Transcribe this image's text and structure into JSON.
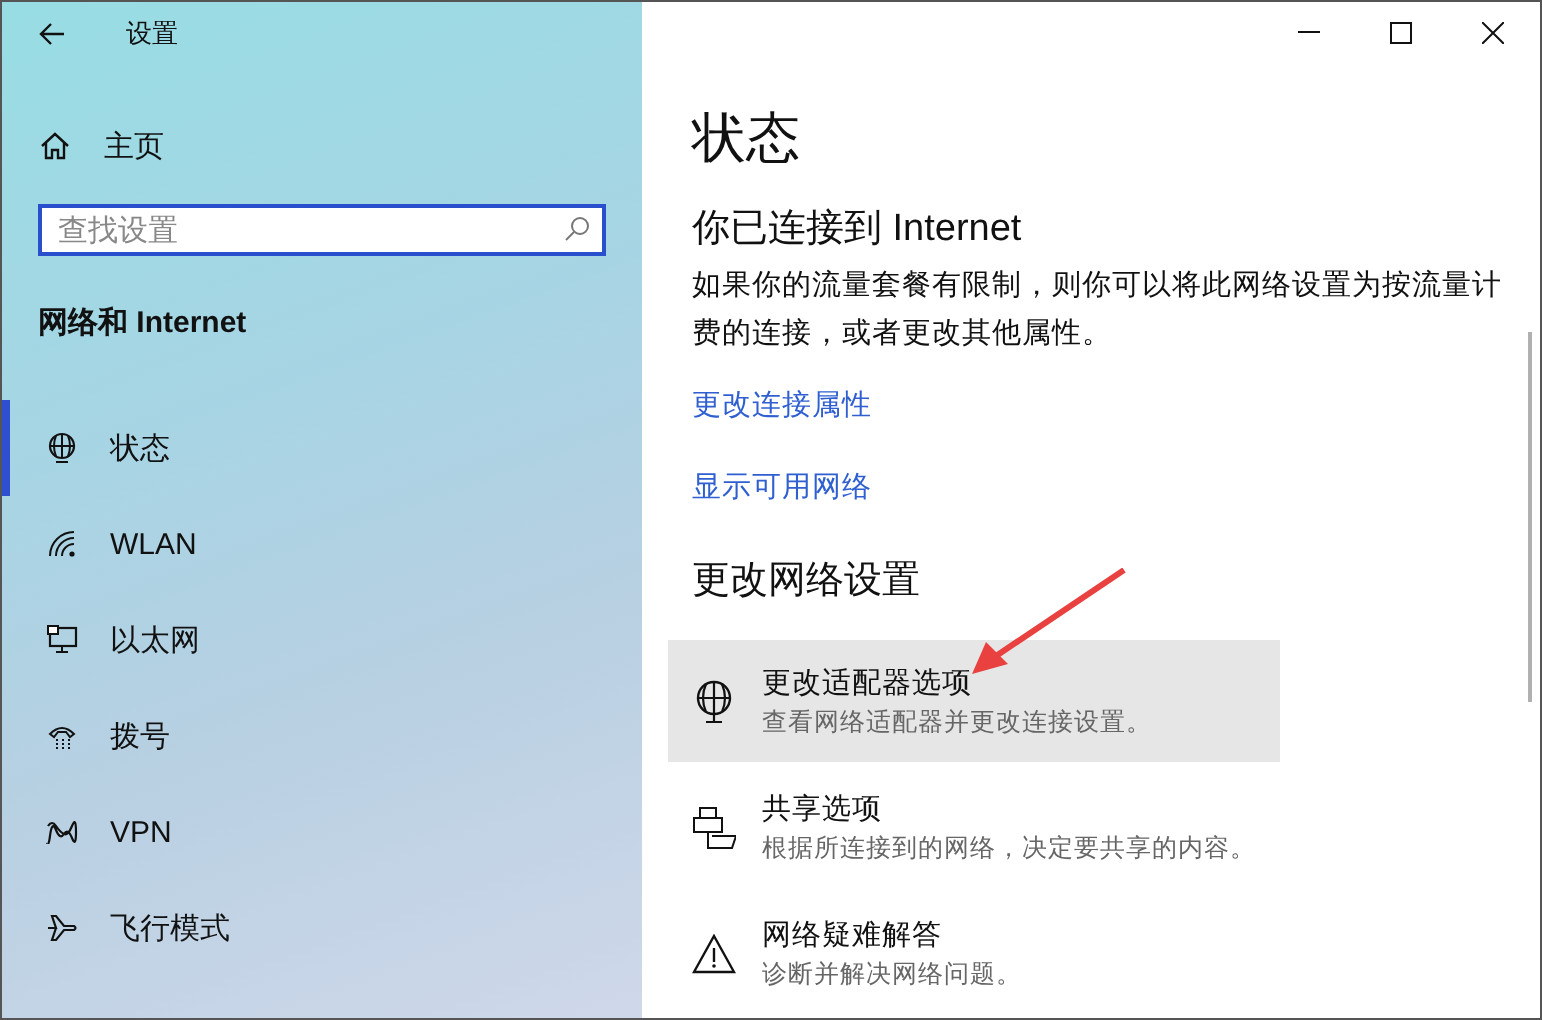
{
  "window": {
    "title": "设置"
  },
  "sidebar": {
    "home": "主页",
    "search": {
      "placeholder": "查找设置"
    },
    "section": "网络和 Internet",
    "items": [
      {
        "label": "状态",
        "selected": true
      },
      {
        "label": "WLAN",
        "selected": false
      },
      {
        "label": "以太网",
        "selected": false
      },
      {
        "label": "拨号",
        "selected": false
      },
      {
        "label": "VPN",
        "selected": false
      },
      {
        "label": "飞行模式",
        "selected": false
      }
    ]
  },
  "content": {
    "title": "状态",
    "heading": "你已连接到 Internet",
    "description": "如果你的流量套餐有限制，则你可以将此网络设置为按流量计费的连接，或者更改其他属性。",
    "links": [
      "更改连接属性",
      "显示可用网络"
    ],
    "section": "更改网络设置",
    "settings": [
      {
        "title": "更改适配器选项",
        "subtitle": "查看网络适配器并更改连接设置。",
        "highlighted": true
      },
      {
        "title": "共享选项",
        "subtitle": "根据所连接到的网络，决定要共享的内容。",
        "highlighted": false
      },
      {
        "title": "网络疑难解答",
        "subtitle": "诊断并解决网络问题。",
        "highlighted": false
      }
    ]
  }
}
